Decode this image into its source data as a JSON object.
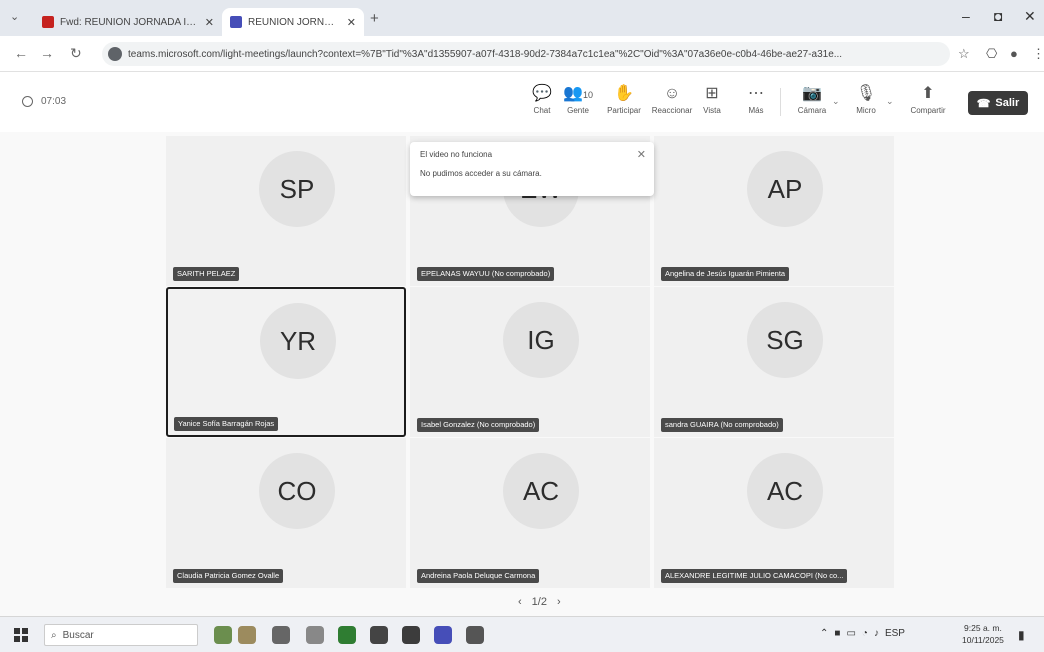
{
  "browser": {
    "tabs": [
      {
        "title": "Fwd: REUNION JORNADA INTE...",
        "close": "✕",
        "favicon_color": "#c5221f"
      },
      {
        "title": "REUNION JORNADA INTE...",
        "close": "✕",
        "favicon_color": "#464eb8"
      }
    ],
    "new_tab": "+",
    "url": "teams.microsoft.com/light-meetings/launch?context=%7B\"Tid\"%3A\"d1355907-a07f-4318-90d2-7384a7c1c1ea\"%2C\"Oid\"%3A\"07a36e0e-c0b4-46be-ae27-a31e...",
    "window_controls": {
      "minimize": "–",
      "maximize": "◘",
      "close": "✕"
    }
  },
  "meeting": {
    "timer": "07:03",
    "toolbar": {
      "chat": "Chat",
      "gente": "Gente",
      "gente_count": "10",
      "participar": "Participar",
      "reaccionar": "Reaccionar",
      "vista": "Vista",
      "mas": "Más",
      "camara": "Cámara",
      "micro": "Micro",
      "compartir": "Compartir",
      "salir": "Salir"
    },
    "toast": {
      "title": "El video no funciona",
      "message": "No pudimos acceder a su cámara."
    },
    "participants": [
      {
        "initials": "SP",
        "name": "SARITH PELAEZ"
      },
      {
        "initials": "EW",
        "name": "EPELANAS WAYUU (No comprobado)"
      },
      {
        "initials": "AP",
        "name": "Angelina de Jesús Iguarán Pimienta"
      },
      {
        "initials": "YR",
        "name": "Yanice Sofía Barragán Rojas"
      },
      {
        "initials": "IG",
        "name": "Isabel Gonzalez (No comprobado)"
      },
      {
        "initials": "SG",
        "name": "sandra GUAIRA (No comprobado)"
      },
      {
        "initials": "CO",
        "name": "Claudia Patricia Gomez Ovalle"
      },
      {
        "initials": "AC",
        "name": "Andreina Paola Deluque Carmona"
      },
      {
        "initials": "AC",
        "name": "ALEXANDRE LEGITIME JULIO CAMACOPI (No co..."
      }
    ],
    "pager": {
      "prev": "‹",
      "label": "1/2",
      "next": "›"
    }
  },
  "taskbar": {
    "search_placeholder": "Buscar",
    "time": "9:25 a. m.",
    "date": "10/11/2025",
    "lang": "ESP"
  }
}
